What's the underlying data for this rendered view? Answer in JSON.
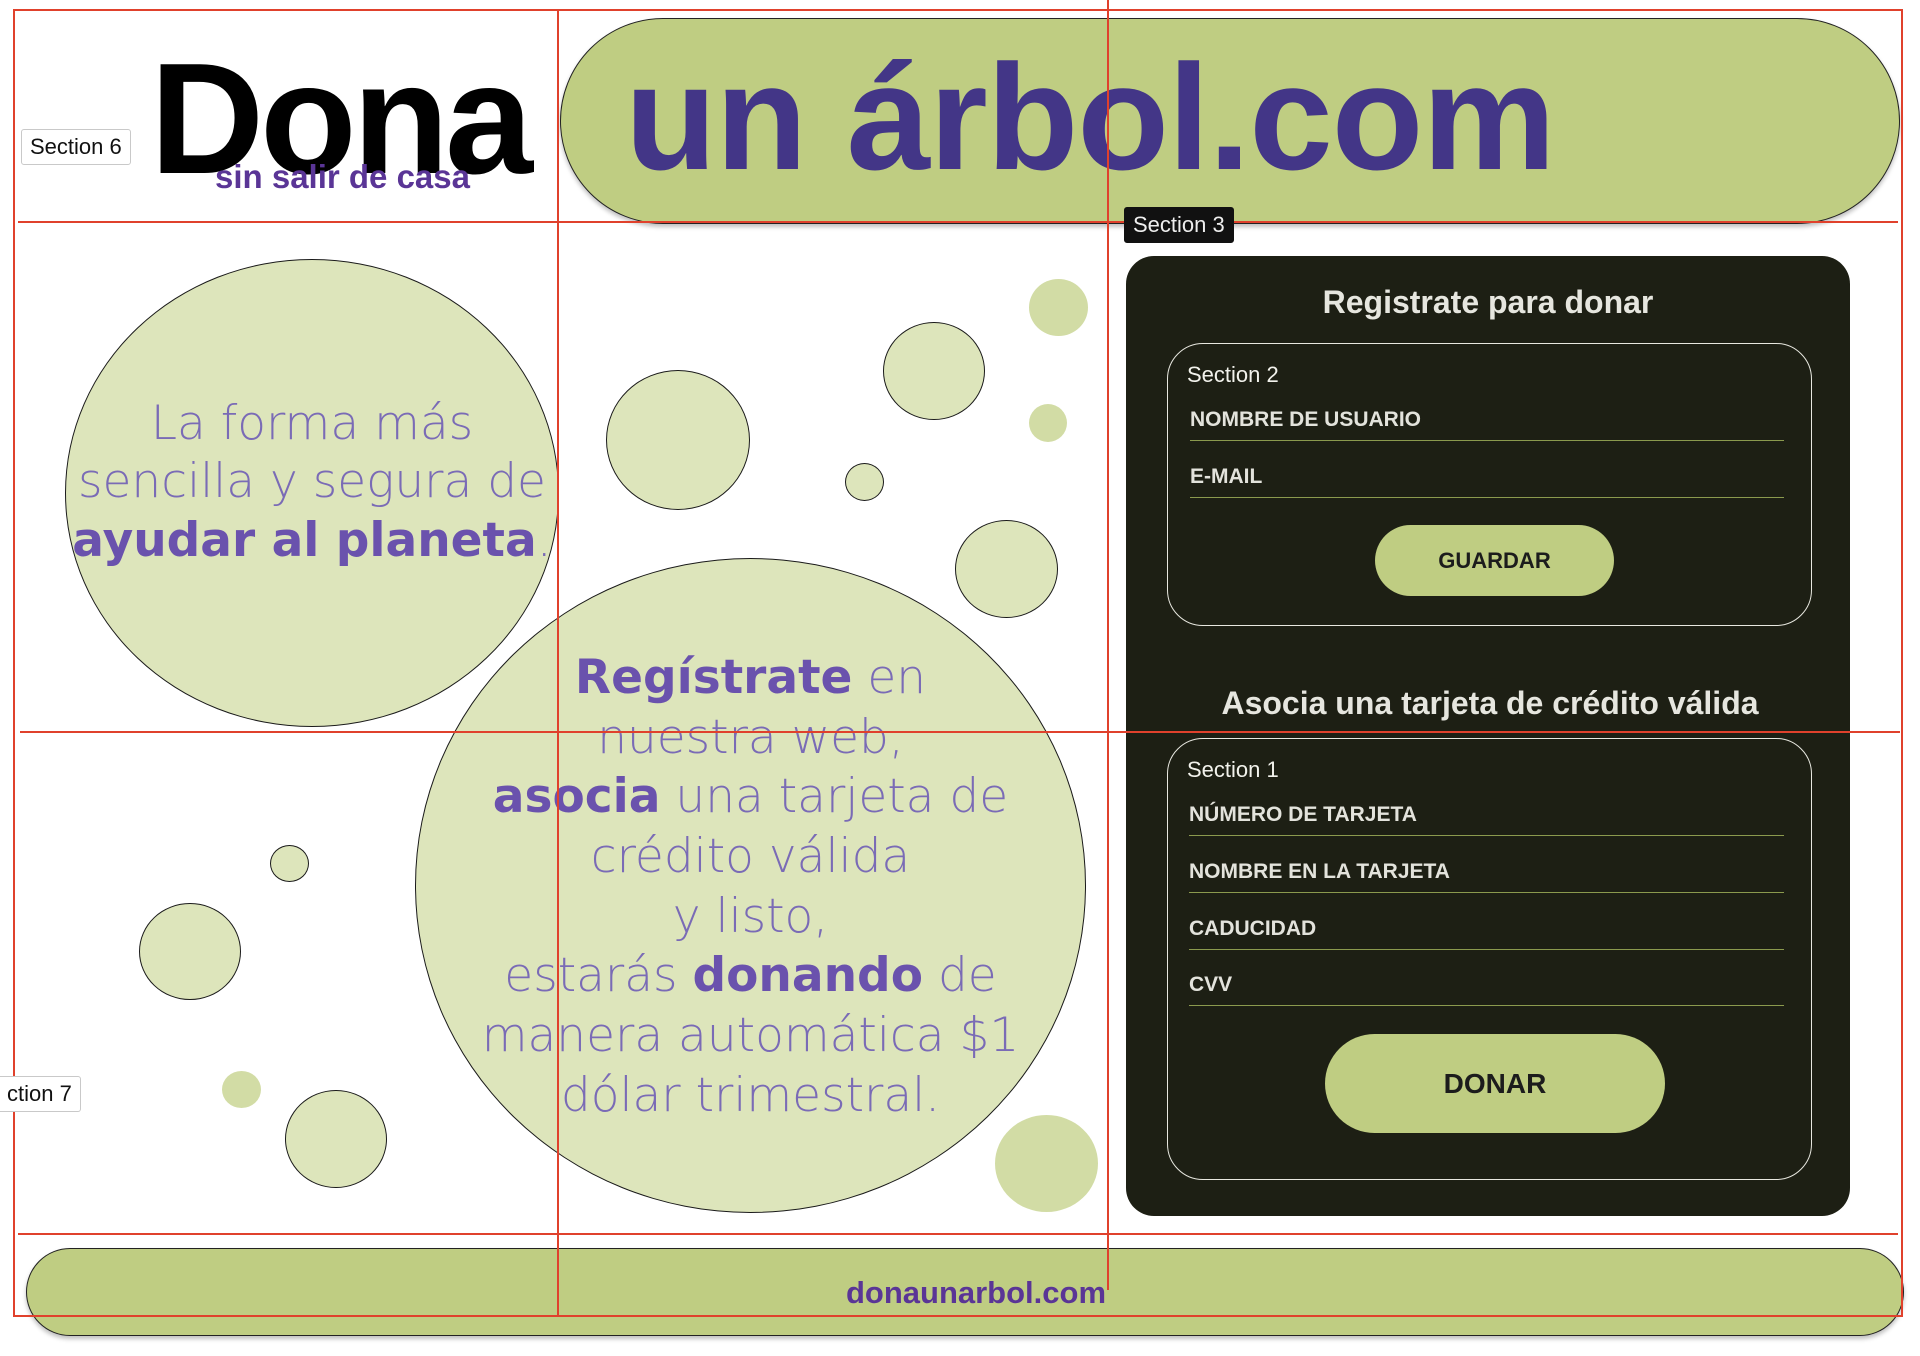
{
  "colors": {
    "accent_green": "#bfcd82",
    "bubble_green": "#dde5bb",
    "purple_dark": "#433687",
    "purple_text": "#7a6bb6",
    "card_bg": "#1d1f14",
    "grid_red": "#e0412c"
  },
  "sections": {
    "header_left": "Section 6",
    "card": "Section 3",
    "register_box": "Section 2",
    "card_box": "Section 1",
    "left_bottom": "ction 7"
  },
  "header": {
    "logo_word": "Dona",
    "tagline": "sin salir de casa",
    "banner_text": "un árbol.com"
  },
  "intro": {
    "line1": "La forma más",
    "line2": "sencilla y segura de",
    "emphasis": "ayudar al planeta",
    "end": "."
  },
  "steps": {
    "register_word": "Regístrate",
    "register_rest": " en",
    "line2": "nuestra web,",
    "associate_word": "asocia",
    "associate_rest": " una tarjeta de",
    "line4": "crédito válida",
    "line5": "y listo,",
    "donating_pre": "estarás ",
    "donating_word": "donando",
    "donating_post": " de",
    "line7": "manera automática $1",
    "line8": "dólar trimestral."
  },
  "register_form": {
    "title": "Registrate para donar",
    "fields": [
      "NOMBRE DE USUARIO",
      "E-MAIL"
    ],
    "button": "GUARDAR"
  },
  "card_form": {
    "title": "Asocia una tarjeta de crédito válida",
    "fields": [
      "NÚMERO DE TARJETA",
      "NOMBRE EN LA TARJETA",
      "CADUCIDAD",
      "CVV"
    ],
    "button": "DONAR"
  },
  "footer": {
    "link": "donaunarbol.com"
  }
}
